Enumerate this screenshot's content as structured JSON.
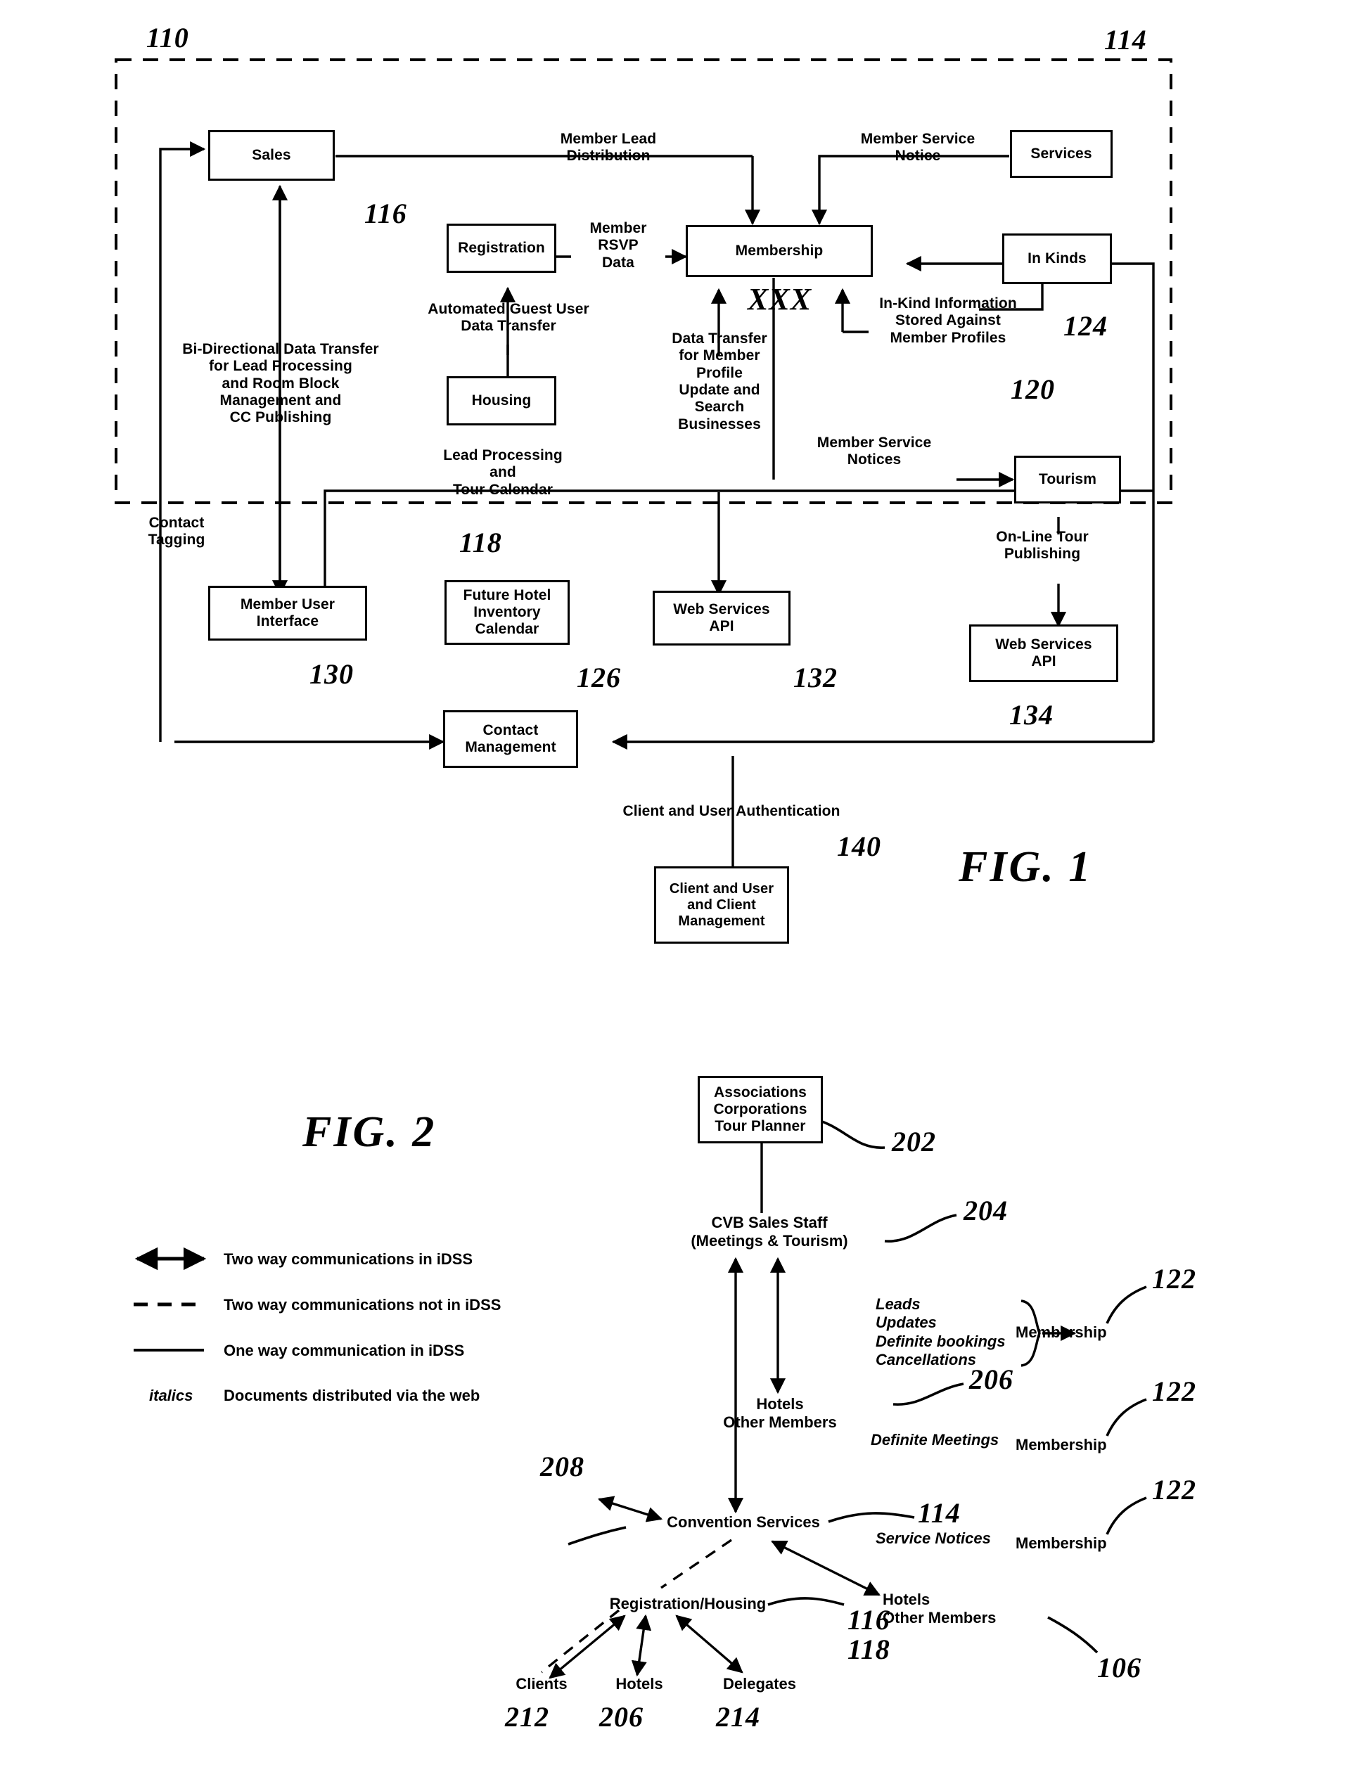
{
  "figure1": {
    "title": "FIG. 1",
    "boundary_ref_left": "110",
    "boundary_ref_right": "114",
    "boxes": {
      "sales": "Sales",
      "services": "Services",
      "registration": "Registration",
      "membership": "Membership",
      "in_kinds": "In Kinds",
      "housing": "Housing",
      "tourism": "Tourism",
      "member_user_interface": "Member User\nInterface",
      "future_hotel_inventory_calendar": "Future Hotel\nInventory\nCalendar",
      "web_services_api_1": "Web Services\nAPI",
      "web_services_api_2": "Web Services\nAPI",
      "contact_management": "Contact\nManagement",
      "client_user_client_management": "Client and User\nand Client\nManagement"
    },
    "flow_labels": {
      "member_lead_distribution": "Member Lead\nDistribution",
      "member_service_notice": "Member Service\nNotice",
      "member_rsvp_data": "Member\nRSVP\nData",
      "automated_guest_user_data_transfer": "Automated Guest User\nData Transfer",
      "in_kind_information": "In-Kind Information\nStored Against\nMember Profiles",
      "bi_directional_data_transfer": "Bi-Directional Data Transfer\nfor Lead Processing\nand Room Block\nManagement and\nCC Publishing",
      "data_transfer_member_profile": "Data Transfer\nfor Member\nProfile\nUpdate and\nSearch\nBusinesses",
      "member_service_notices": "Member Service\nNotices",
      "lead_processing_tour_calendar": "Lead Processing\nand\nTour Calendar",
      "contact_tagging": "Contact\nTagging",
      "on_line_tour_publishing": "On-Line Tour\nPublishing",
      "client_user_authentication": "Client and User Authentication"
    },
    "annotation_xxx": "XXX",
    "refs": {
      "r116": "116",
      "r118": "118",
      "r120": "120",
      "r124": "124",
      "r126": "126",
      "r130": "130",
      "r132": "132",
      "r134": "134",
      "r140": "140"
    }
  },
  "figure2": {
    "title": "FIG. 2",
    "legend": [
      {
        "symbol": "double-arrow",
        "text": "Two way communications in iDSS"
      },
      {
        "symbol": "dashed-line",
        "text": "Two way communications not in iDSS"
      },
      {
        "symbol": "solid-line",
        "text": "One way communication in iDSS"
      },
      {
        "symbol": "italics",
        "symbol_label": "italics",
        "text": "Documents distributed via the web"
      }
    ],
    "nodes": {
      "associations_box": "Associations\nCorporations\nTour Planner",
      "cvb_sales_staff": "CVB Sales Staff\n(Meetings & Tourism)",
      "hotels_other_members_1": "Hotels\nOther Members",
      "membership_1": "Membership",
      "membership_2": "Membership",
      "membership_3": "Membership",
      "convention_services": "Convention Services",
      "registration_housing": "Registration/Housing",
      "hotels_other_members_2": "Hotels\nOther Members",
      "clients": "Clients",
      "hotels": "Hotels",
      "delegates": "Delegates"
    },
    "italic_labels": {
      "leads_updates": "Leads\nUpdates\nDefinite bookings\nCancellations",
      "definite_meetings": "Definite Meetings",
      "service_notices": "Service Notices"
    },
    "refs": {
      "r202": "202",
      "r204": "204",
      "r206a": "206",
      "r122a": "122",
      "r122b": "122",
      "r122c": "122",
      "r208": "208",
      "r114": "114",
      "r116": "116",
      "r118": "118",
      "r106": "106",
      "r212": "212",
      "r206b": "206",
      "r214": "214"
    }
  }
}
